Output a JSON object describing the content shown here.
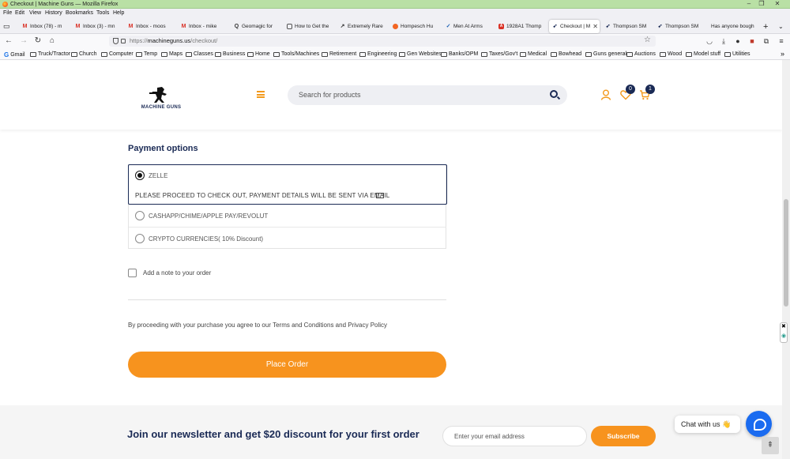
{
  "browser": {
    "window_title": "Checkout | Machine Guns — Mozilla Firefox",
    "menu": [
      "File",
      "Edit",
      "View",
      "History",
      "Bookmarks",
      "Tools",
      "Help"
    ],
    "tabs": [
      {
        "label": "Inbox (78) - m",
        "icon": "gmail-icon"
      },
      {
        "label": "Inbox (3) - mn",
        "icon": "gmail-icon"
      },
      {
        "label": "Inbox - moos",
        "icon": "gmail-icon"
      },
      {
        "label": "Inbox - mike",
        "icon": "gmail-icon"
      },
      {
        "label": "Geomagic for",
        "icon": "q-icon"
      },
      {
        "label": "How to Get the",
        "icon": "page-icon"
      },
      {
        "label": "Extremely Rare",
        "icon": "page-icon"
      },
      {
        "label": "Hompesch Hu",
        "icon": "page-icon"
      },
      {
        "label": "Men At Arms",
        "icon": "page-icon"
      },
      {
        "label": "1928A1 Thomp",
        "icon": "page-icon"
      },
      {
        "label": "Checkout | M",
        "icon": "page-icon",
        "active": true
      },
      {
        "label": "Thompson SM",
        "icon": "page-icon"
      },
      {
        "label": "Thompson SM",
        "icon": "page-icon"
      },
      {
        "label": "Has anyone bough",
        "icon": "page-icon"
      }
    ],
    "url_prefix": "https://",
    "url_host": "machineguns.us",
    "url_path": "/checkout/",
    "bookmarks": [
      "Gmail",
      "Truck/Tractor",
      "Church",
      "Computer",
      "Temp",
      "Maps",
      "Classes",
      "Business",
      "Home",
      "Tools/Machines",
      "Retirement",
      "Engineering",
      "Gen Websites",
      "Banks/OPM",
      "Taxes/Gov't",
      "Medical",
      "Bowhead",
      "Guns general",
      "Auctions",
      "Wood",
      "Model stuff",
      "Utilities"
    ]
  },
  "site": {
    "logo_text": "MACHINE GUNS",
    "search_placeholder": "Search for products",
    "wishlist_count": "0",
    "cart_count": "1",
    "accent_color": "#f7931e",
    "navy_color": "#1a2a55"
  },
  "checkout": {
    "payment_title": "Payment options",
    "options": [
      {
        "label": "ZELLE",
        "selected": true,
        "description": "PLEASE PROCEED TO CHECK OUT, PAYMENT DETAILS WILL BE SENT VIA EMAIL"
      },
      {
        "label": "CASHAPP/CHIME/APPLE PAY/REVOLUT",
        "selected": false
      },
      {
        "label": "CRYPTO CURRENCIES( 10% Discount)",
        "selected": false
      }
    ],
    "note_label": "Add a note to your order",
    "terms_text": "By proceeding with your purchase you agree to our Terms and Conditions and Privacy Policy",
    "place_order": "Place Order"
  },
  "newsletter": {
    "title": "Join our newsletter and get $20 discount for your first order",
    "email_placeholder": "Enter your email address",
    "subscribe": "Subscribe"
  },
  "chat": {
    "label": "Chat with us",
    "emoji": "👋"
  }
}
